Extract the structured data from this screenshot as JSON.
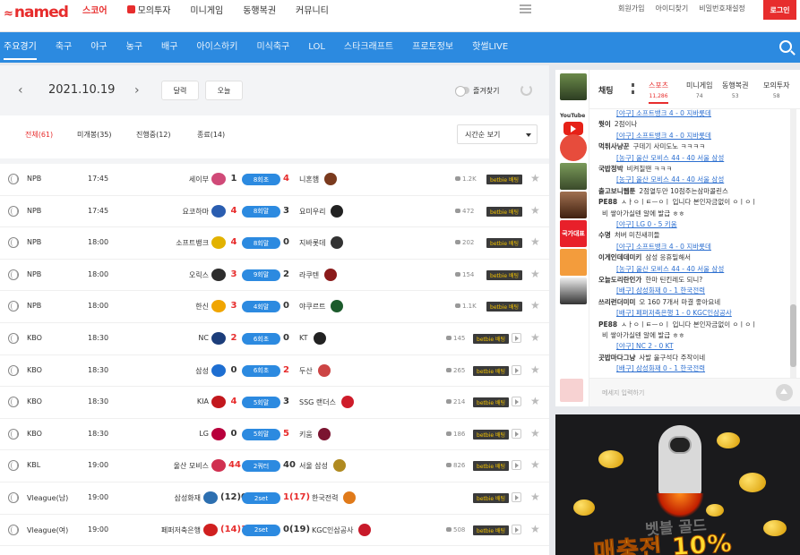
{
  "header": {
    "logo": "named",
    "nav": [
      {
        "label": "스코어",
        "active": true
      },
      {
        "label": "모의투자",
        "active": false
      },
      {
        "label": "미니게임",
        "active": false
      },
      {
        "label": "동행복권",
        "active": false
      },
      {
        "label": "커뮤니티",
        "active": false
      }
    ],
    "util": [
      "회원가입",
      "아이디찾기",
      "비밀번호재설정"
    ],
    "login": "로그인"
  },
  "sports": [
    "주요경기",
    "축구",
    "야구",
    "농구",
    "배구",
    "아이스하키",
    "미식축구",
    "LOL",
    "스타크래프트",
    "프로토정보",
    "핫썰LIVE"
  ],
  "datebar": {
    "date": "2021.10.19",
    "calendar": "달력",
    "today": "오늘",
    "favorite": "즐겨찾기"
  },
  "filters": [
    {
      "label": "전체(61)",
      "active": true
    },
    {
      "label": "미개봉(35)",
      "active": false
    },
    {
      "label": "진행중(12)",
      "active": false
    },
    {
      "label": "종료(14)",
      "active": false
    }
  ],
  "sort": "시간순 보기",
  "games": [
    {
      "league": "NPB",
      "time": "17:45",
      "home": "세이부",
      "hscore": "1",
      "status": "8회초",
      "ascore": "4",
      "away": "니혼햄",
      "chat": "1.2K",
      "bet": "betbie 배팅",
      "play": false,
      "win": "away",
      "hcolor": "#d04a78",
      "acolor": "#7a3a1e"
    },
    {
      "league": "NPB",
      "time": "17:45",
      "home": "요코하마",
      "hscore": "4",
      "status": "8회말",
      "ascore": "3",
      "away": "요미우리",
      "chat": "472",
      "bet": "betbie 배팅",
      "play": false,
      "win": "home",
      "hcolor": "#2a5db0",
      "acolor": "#222"
    },
    {
      "league": "NPB",
      "time": "18:00",
      "home": "소프트뱅크",
      "hscore": "4",
      "status": "8회말",
      "ascore": "0",
      "away": "지바롯데",
      "chat": "202",
      "bet": "betbie 배팅",
      "play": false,
      "win": "home",
      "hcolor": "#e2b200",
      "acolor": "#333"
    },
    {
      "league": "NPB",
      "time": "18:00",
      "home": "오릭스",
      "hscore": "3",
      "status": "9회말",
      "ascore": "2",
      "away": "라쿠텐",
      "chat": "154",
      "bet": "betbie 배팅",
      "play": false,
      "win": "home",
      "hcolor": "#2d2d2d",
      "acolor": "#8a1a1a"
    },
    {
      "league": "NPB",
      "time": "18:00",
      "home": "한신",
      "hscore": "3",
      "status": "4회말",
      "ascore": "0",
      "away": "야쿠르트",
      "chat": "1.1K",
      "bet": "betbie 배팅",
      "play": false,
      "win": "home",
      "hcolor": "#f0a500",
      "acolor": "#1c5b2c"
    },
    {
      "league": "KBO",
      "time": "18:30",
      "home": "NC",
      "hscore": "2",
      "status": "6회초",
      "ascore": "0",
      "away": "KT",
      "chat": "145",
      "bet": "betbie 배팅",
      "play": true,
      "win": "home",
      "hcolor": "#1c3d7a",
      "acolor": "#222"
    },
    {
      "league": "KBO",
      "time": "18:30",
      "home": "삼성",
      "hscore": "0",
      "status": "6회초",
      "ascore": "2",
      "away": "두산",
      "chat": "265",
      "bet": "betbie 배팅",
      "play": true,
      "win": "away",
      "hcolor": "#1e6ed1",
      "acolor": "#c44"
    },
    {
      "league": "KBO",
      "time": "18:30",
      "home": "KIA",
      "hscore": "4",
      "status": "5회말",
      "ascore": "3",
      "away": "SSG 랜더스",
      "chat": "214",
      "bet": "betbie 배팅",
      "play": true,
      "win": "home",
      "hcolor": "#c2181d",
      "acolor": "#ce1c2a"
    },
    {
      "league": "KBO",
      "time": "18:30",
      "home": "LG",
      "hscore": "0",
      "status": "5회말",
      "ascore": "5",
      "away": "키움",
      "chat": "186",
      "bet": "betbie 배팅",
      "play": true,
      "win": "away",
      "hcolor": "#b8003c",
      "acolor": "#7b1531"
    },
    {
      "league": "KBL",
      "time": "19:00",
      "home": "울산 모비스",
      "hscore": "44",
      "status": "2쿼터",
      "ascore": "40",
      "away": "서울 삼성",
      "chat": "826",
      "bet": "betbie 배팅",
      "play": true,
      "win": "home",
      "hcolor": "#d03050",
      "acolor": "#b08a20"
    },
    {
      "league": "Vleague(남)",
      "time": "19:00",
      "home": "삼성화재",
      "hscore": "(12)0",
      "status": "2set",
      "ascore": "1(17)",
      "away": "한국전력",
      "chat": "",
      "bet": "betbie 배팅",
      "play": true,
      "win": "away",
      "hcolor": "#2d6fb0",
      "acolor": "#e07a1a"
    },
    {
      "league": "Vleague(여)",
      "time": "19:00",
      "home": "페퍼저축은행",
      "hscore": "(14)1",
      "status": "2set",
      "ascore": "0(19)",
      "away": "KGC인삼공사",
      "chat": "508",
      "bet": "betbie 배팅",
      "play": true,
      "win": "home",
      "hcolor": "#d02020",
      "acolor": "#c81a2a"
    }
  ],
  "chat": {
    "label": "채팅",
    "tabs": [
      {
        "label": "스포츠",
        "count": "11,286",
        "active": true
      },
      {
        "label": "미니게임",
        "count": "74",
        "active": false
      },
      {
        "label": "동행복권",
        "count": "53",
        "active": false
      },
      {
        "label": "모의투자",
        "count": "58",
        "active": false
      }
    ],
    "messages": [
      {
        "type": "link",
        "text": "[야구] 소프트뱅크 4 - 0 지바롯데"
      },
      {
        "type": "msg",
        "user": "뭣이",
        "text": "2점이나"
      },
      {
        "type": "link",
        "text": "[야구] 소프트뱅크 4 - 0 지바롯데"
      },
      {
        "type": "msg",
        "user": "먹튀사냥꾼",
        "text": "구데기 사미도노 ㅋㅋㅋㅋ"
      },
      {
        "type": "link",
        "text": "[농구] 울산 모비스 44 - 40 서울 삼성"
      },
      {
        "type": "msg",
        "user": "국밥정박",
        "text": "비켜칠땐 ㅋㅋㅋ"
      },
      {
        "type": "link",
        "text": "[농구] 울산 모비스 44 - 40 서울 삼성"
      },
      {
        "type": "msg",
        "user": "출고보니웹툰",
        "text": "2점열두만 10점주는삼마콜린스"
      },
      {
        "type": "msg",
        "user": "PE88",
        "text": "ㅅㅏㅇㅣㅌㅡㅇㅣ 입니다 본인자금없이 ㅇㅣㅇㅣ"
      },
      {
        "type": "msg",
        "user": "",
        "text": "비 쌓아가실텐 알에 발급 ㅎㅎ"
      },
      {
        "type": "link",
        "text": "[야구] LG 0 - 5 키움"
      },
      {
        "type": "msg",
        "user": "수명",
        "text": "처버 미친새끼들"
      },
      {
        "type": "link",
        "text": "[야구] 소프트뱅크 4 - 0 지바롯데"
      },
      {
        "type": "msg",
        "user": "이게인데데미키",
        "text": "삼성 응휴밀해서"
      },
      {
        "type": "link",
        "text": "[농구] 울산 모비스 44 - 40 서울 삼성"
      },
      {
        "type": "msg",
        "user": "오늘도리란인가",
        "text": "한마 틴킨레도 되니?"
      },
      {
        "type": "link",
        "text": "[배구] 삼성화재 0 - 1 한국전력"
      },
      {
        "type": "msg",
        "user": "쓰리런더미미",
        "text": "오 160 7개서 마결 좋아요네"
      },
      {
        "type": "link",
        "text": "[배구] 페퍼저축은행 1 - 0 KGC인삼공사"
      },
      {
        "type": "msg",
        "user": "PE88",
        "text": "ㅅㅏㅇㅣㅌㅡㅇㅣ 입니다 본인자금없이 ㅇㅣㅇㅣ"
      },
      {
        "type": "msg",
        "user": "",
        "text": "비 쌓아가실텐 알에 발급 ㅎㅎ"
      },
      {
        "type": "link",
        "text": "[야구] NC 2 - 0 KT"
      },
      {
        "type": "msg",
        "user": "곳밥마다그냥",
        "text": "사발 울구석다 주작이네"
      },
      {
        "type": "link",
        "text": "[배구] 삼성화재 0 - 1 한국전력"
      }
    ],
    "placeholder": "메세지 입력하기"
  },
  "sidebar_apps": {
    "youtube": "YouTube",
    "gamble": "국가대표"
  },
  "ad": {
    "line1": "벳블 골드",
    "line2": "매충전 10%"
  }
}
